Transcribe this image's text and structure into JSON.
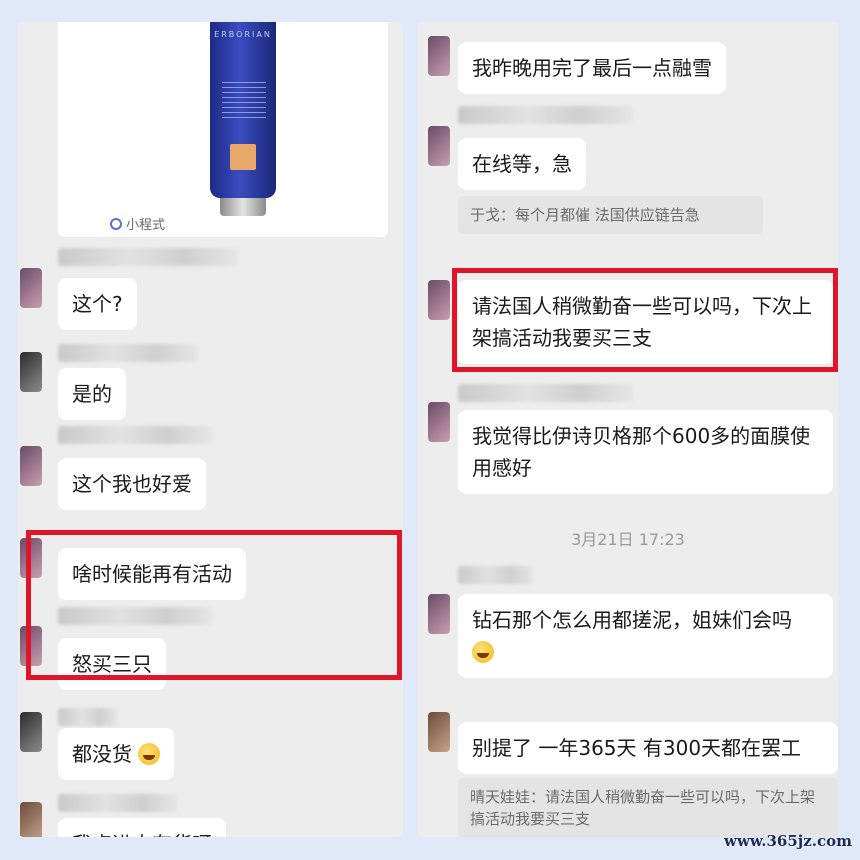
{
  "left": {
    "product_card": {
      "brand": "ERBORIAN",
      "label": "小程式"
    },
    "messages": [
      {
        "text": "这个?"
      },
      {
        "text": "是的"
      },
      {
        "text": "这个我也好爱"
      },
      {
        "text": "啥时候能再有活动"
      },
      {
        "text": "怒买三只"
      },
      {
        "text": "都没货",
        "emoji": "crying-laughing-emoji"
      },
      {
        "text": "我点进去有货呀"
      }
    ]
  },
  "right": {
    "messages": [
      {
        "text": "我昨晚用完了最后一点融雪"
      },
      {
        "text": "在线等，急"
      },
      {
        "quote": "于戈：每个月都催 法国供应链告急"
      },
      {
        "text": "请法国人稍微勤奋一些可以吗，下次上架搞活动我要买三支"
      },
      {
        "text": "我觉得比伊诗贝格那个600多的面膜使用感好"
      },
      {
        "time": "3月21日 17:23"
      },
      {
        "text": "钻石那个怎么用都搓泥，姐妹们会吗",
        "emoji": "crying-laughing-emoji"
      },
      {
        "text": "别提了 一年365天 有300天都在罢工"
      },
      {
        "quote": "晴天娃娃：请法国人稍微勤奋一些可以吗，下次上架搞活动我要买三支"
      }
    ]
  },
  "watermark": "www.365jz.com",
  "colors": {
    "highlight": "#e0152a",
    "background": "#dfe9f7",
    "chat_bg": "#ededed"
  }
}
